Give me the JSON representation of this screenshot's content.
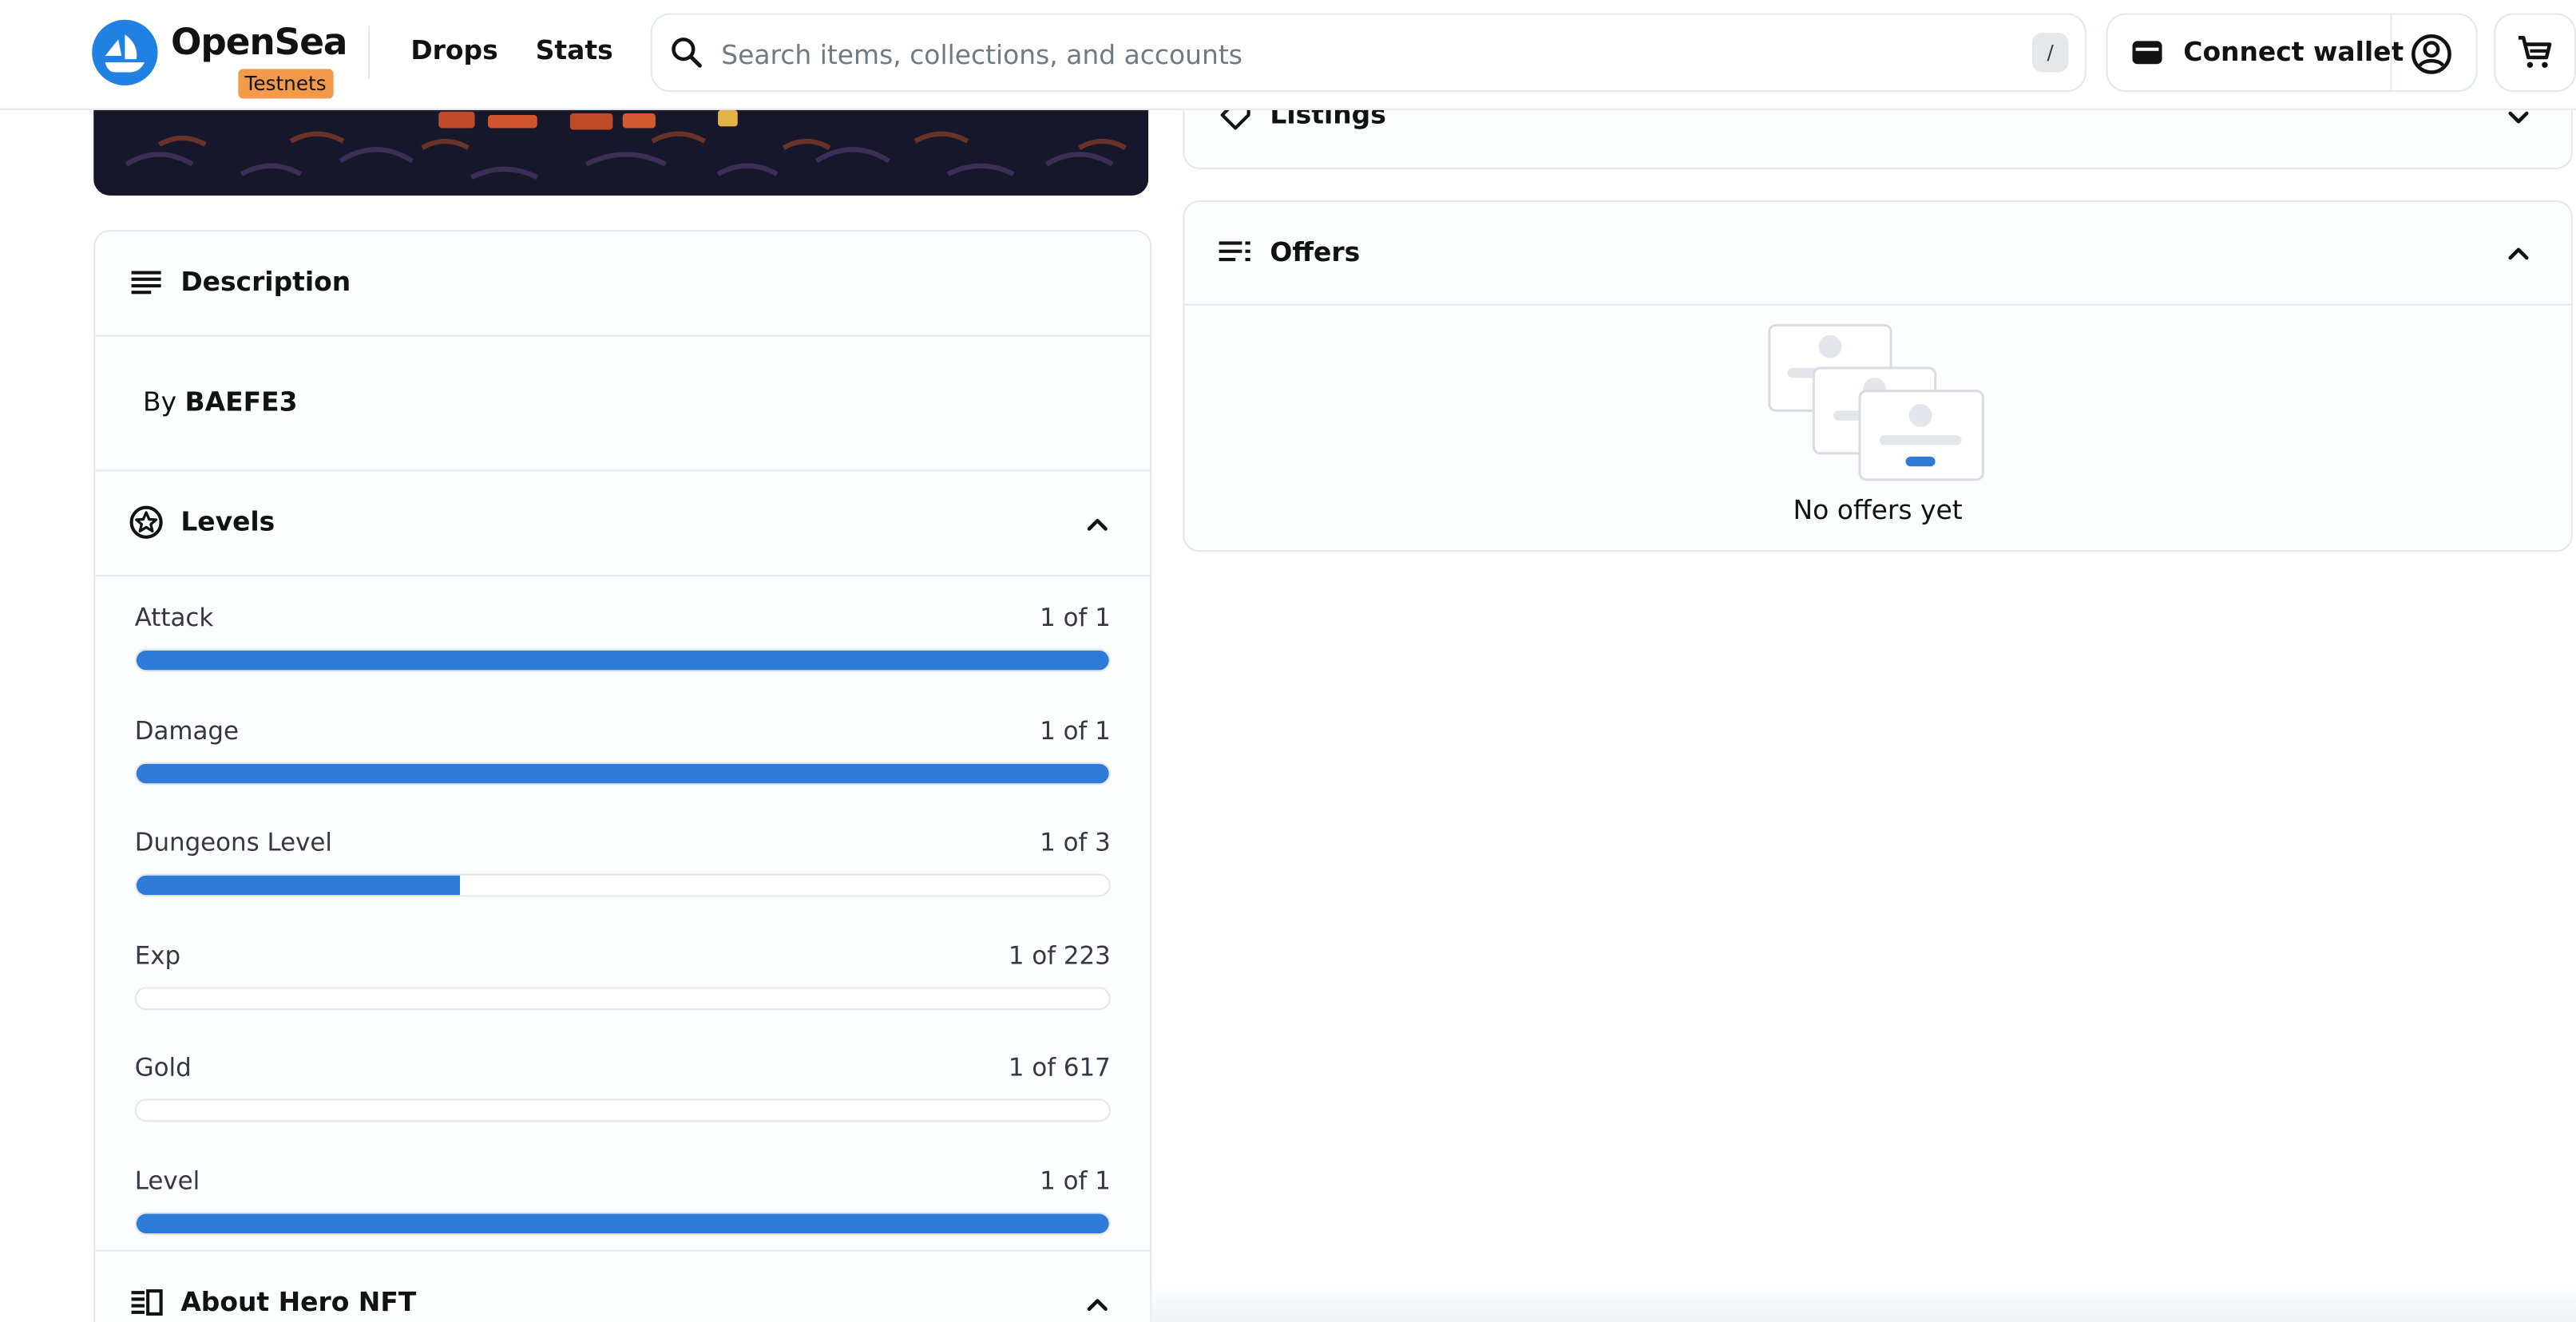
{
  "header": {
    "logo_text": "OpenSea",
    "testnets_badge": "Testnets",
    "nav": {
      "drops": "Drops",
      "stats": "Stats"
    },
    "search": {
      "placeholder": "Search items, collections, and accounts",
      "shortcut": "/"
    },
    "wallet_label": "Connect wallet"
  },
  "description": {
    "title": "Description",
    "by_prefix": "By",
    "creator": "BAEFE3"
  },
  "levels": {
    "title": "Levels",
    "items": [
      {
        "name": "Attack",
        "value": "1 of 1",
        "fraction": 1.0
      },
      {
        "name": "Damage",
        "value": "1 of 1",
        "fraction": 1.0
      },
      {
        "name": "Dungeons Level",
        "value": "1 of 3",
        "fraction": 0.3333
      },
      {
        "name": "Exp",
        "value": "1 of 223",
        "fraction": 0.0045
      },
      {
        "name": "Gold",
        "value": "1 of 617",
        "fraction": 0.0016
      },
      {
        "name": "Level",
        "value": "1 of 1",
        "fraction": 1.0
      }
    ]
  },
  "about": {
    "title": "About Hero NFT"
  },
  "listings": {
    "title": "Listings"
  },
  "offers": {
    "title": "Offers",
    "empty_text": "No offers yet"
  },
  "colors": {
    "accent": "#2081e2",
    "bar_fill": "#2e7bd8",
    "badge": "#f2994a",
    "border": "#e5e8eb"
  },
  "icons": {
    "logo": "opensea-boat-icon",
    "search": "search-icon",
    "wallet": "wallet-icon",
    "account": "account-circle-icon",
    "cart": "cart-icon",
    "description": "description-lines-icon",
    "levels": "star-circle-icon",
    "about": "article-icon",
    "listings": "tag-icon",
    "offers": "list-icon"
  }
}
